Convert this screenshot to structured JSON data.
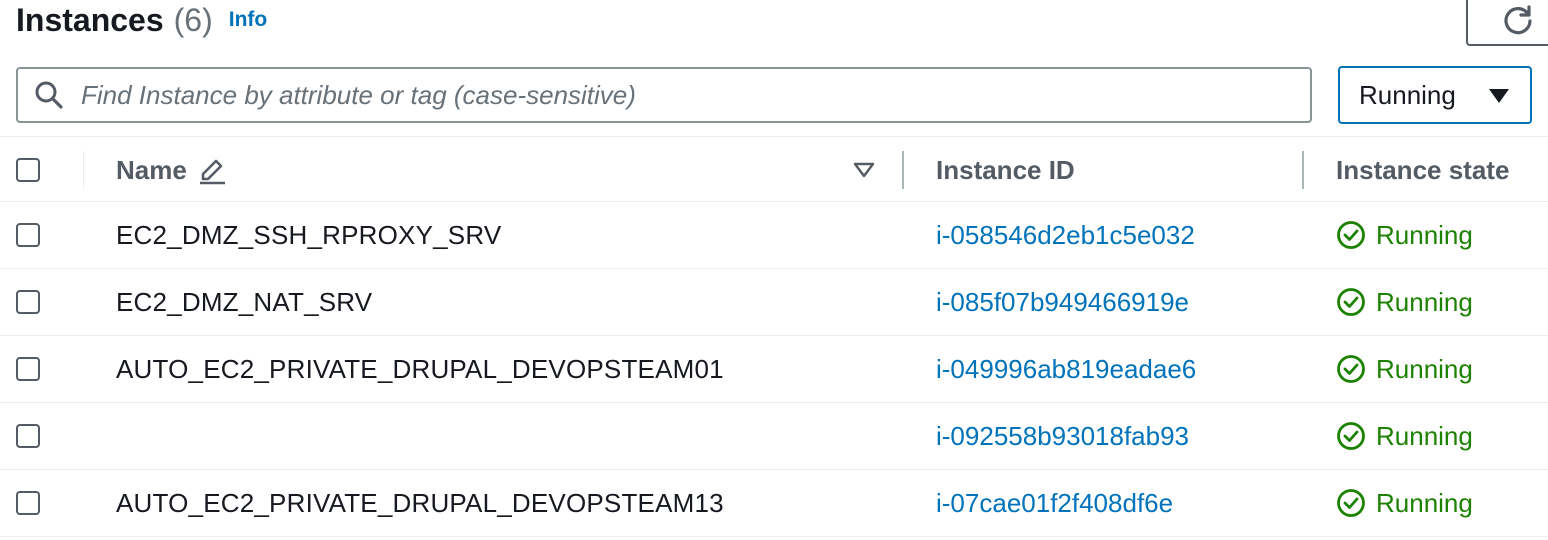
{
  "header": {
    "title": "Instances",
    "count": "(6)",
    "info": "Info",
    "refresh_icon": "refresh-icon"
  },
  "search": {
    "placeholder": "Find Instance by attribute or tag (case-sensitive)",
    "value": "",
    "icon": "search-icon"
  },
  "state_filter": {
    "selected": "Running",
    "icon": "caret-down-icon"
  },
  "table": {
    "columns": [
      {
        "label": "Name",
        "icon": "edit-pencil-icon",
        "sort_icon": "sort-down-icon"
      },
      {
        "label": "Instance ID"
      },
      {
        "label": "Instance state"
      }
    ],
    "rows": [
      {
        "name": "EC2_DMZ_SSH_RPROXY_SRV",
        "instance_id": "i-058546d2eb1c5e032",
        "state": "Running"
      },
      {
        "name": "EC2_DMZ_NAT_SRV",
        "instance_id": "i-085f07b949466919e",
        "state": "Running"
      },
      {
        "name": "AUTO_EC2_PRIVATE_DRUPAL_DEVOPSTEAM01",
        "instance_id": "i-049996ab819eadae6",
        "state": "Running"
      },
      {
        "name": "",
        "instance_id": "i-092558b93018fab93",
        "state": "Running"
      },
      {
        "name": "AUTO_EC2_PRIVATE_DRUPAL_DEVOPSTEAM13",
        "instance_id": "i-07cae01f2f408df6e",
        "state": "Running"
      }
    ]
  },
  "colors": {
    "link": "#0073bb",
    "running": "#1d8102",
    "heading": "#545b64"
  }
}
